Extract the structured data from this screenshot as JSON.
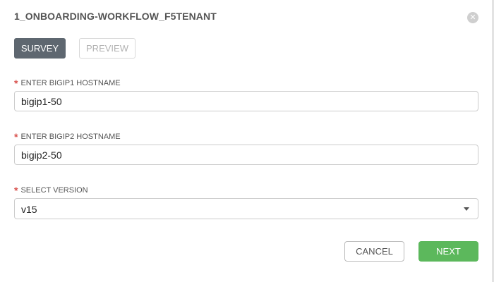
{
  "dialog": {
    "title": "1_ONBOARDING-WORKFLOW_F5TENANT",
    "close_glyph": "✕",
    "close_icon": "close-circle-icon"
  },
  "tabs": {
    "survey": "SURVEY",
    "preview": "PREVIEW",
    "active": "SURVEY"
  },
  "form": {
    "required_marker": "*",
    "bigip1": {
      "label": "ENTER BIGIP1 HOSTNAME",
      "value": "bigip1-50"
    },
    "bigip2": {
      "label": "ENTER BIGIP2 HOSTNAME",
      "value": "bigip2-50"
    },
    "version": {
      "label": "SELECT VERSION",
      "selected": "v15",
      "arrow_icon": "caret-down-icon"
    }
  },
  "actions": {
    "cancel": "CANCEL",
    "next": "NEXT"
  },
  "colors": {
    "active_tab": "#5e6770",
    "next_button": "#5cb85c",
    "required": "#d9534f"
  }
}
